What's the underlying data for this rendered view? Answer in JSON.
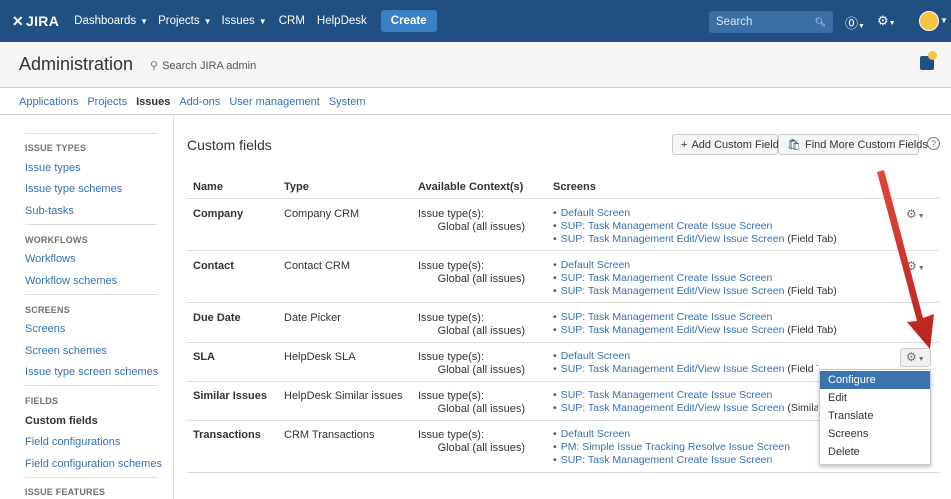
{
  "topbar": {
    "logo": "JIRA",
    "nav": [
      {
        "label": "Dashboards",
        "caret": true
      },
      {
        "label": "Projects",
        "caret": true
      },
      {
        "label": "Issues",
        "caret": true
      },
      {
        "label": "CRM",
        "caret": false
      },
      {
        "label": "HelpDesk",
        "caret": false
      }
    ],
    "create_label": "Create",
    "search_placeholder": "Search"
  },
  "admin": {
    "title": "Administration",
    "search_label": "Search JIRA admin"
  },
  "tabs": [
    "Applications",
    "Projects",
    "Issues",
    "Add-ons",
    "User management",
    "System"
  ],
  "active_tab": "Issues",
  "sidebar": {
    "sections": [
      {
        "title": "ISSUE TYPES",
        "items": [
          "Issue types",
          "Issue type schemes",
          "Sub-tasks"
        ]
      },
      {
        "title": "WORKFLOWS",
        "items": [
          "Workflows",
          "Workflow schemes"
        ]
      },
      {
        "title": "SCREENS",
        "items": [
          "Screens",
          "Screen schemes",
          "Issue type screen schemes"
        ]
      },
      {
        "title": "FIELDS",
        "items": [
          "Custom fields",
          "Field configurations",
          "Field configuration schemes"
        ]
      },
      {
        "title": "ISSUE FEATURES",
        "items": []
      }
    ],
    "active_item": "Custom fields"
  },
  "main": {
    "title": "Custom fields",
    "add_button": "Add Custom Field",
    "find_button": "Find More Custom Fields",
    "help_glyph": "?",
    "columns": [
      "Name",
      "Type",
      "Available Context(s)",
      "Screens"
    ],
    "context_label": "Issue type(s):",
    "context_value": "Global (all issues)",
    "rows": [
      {
        "name": "Company",
        "type": "Company CRM",
        "screens": [
          {
            "link": "Default Screen",
            "suffix": ""
          },
          {
            "link": "SUP: Task Management Create Issue Screen",
            "suffix": ""
          },
          {
            "link": "SUP: Task Management Edit/View Issue Screen",
            "suffix": " (Field Tab)"
          }
        ]
      },
      {
        "name": "Contact",
        "type": "Contact CRM",
        "screens": [
          {
            "link": "Default Screen",
            "suffix": ""
          },
          {
            "link": "SUP: Task Management Create Issue Screen",
            "suffix": ""
          },
          {
            "link": "SUP: Task Management Edit/View Issue Screen",
            "suffix": " (Field Tab)"
          }
        ]
      },
      {
        "name": "Due Date",
        "type": "Date Picker",
        "screens": [
          {
            "link": "SUP: Task Management Create Issue Screen",
            "suffix": ""
          },
          {
            "link": "SUP: Task Management Edit/View Issue Screen",
            "suffix": " (Field Tab)"
          }
        ]
      },
      {
        "name": "SLA",
        "type": "HelpDesk SLA",
        "screens": [
          {
            "link": "Default Screen",
            "suffix": ""
          },
          {
            "link": "SUP: Task Management Edit/View Issue Screen",
            "suffix": " (Field Tab)"
          }
        ]
      },
      {
        "name": "Similar Issues",
        "type": "HelpDesk Similar issues",
        "screens": [
          {
            "link": "SUP: Task Management Create Issue Screen",
            "suffix": ""
          },
          {
            "link": "SUP: Task Management Edit/View Issue Screen",
            "suffix": " (Similar Is"
          }
        ]
      },
      {
        "name": "Transactions",
        "type": "CRM Transactions",
        "screens": [
          {
            "link": "Default Screen",
            "suffix": ""
          },
          {
            "link": "PM: Simple Issue Tracking Resolve Issue Screen",
            "suffix": ""
          },
          {
            "link": "SUP: Task Management Create Issue Screen",
            "suffix": ""
          }
        ]
      }
    ]
  },
  "dropdown": {
    "items": [
      "Configure",
      "Edit",
      "Translate",
      "Screens",
      "Delete"
    ],
    "highlighted": "Configure"
  },
  "colors": {
    "topbar": "#205081",
    "link": "#3572b0",
    "highlight": "#3b73af",
    "arrow": "#d9342b"
  }
}
